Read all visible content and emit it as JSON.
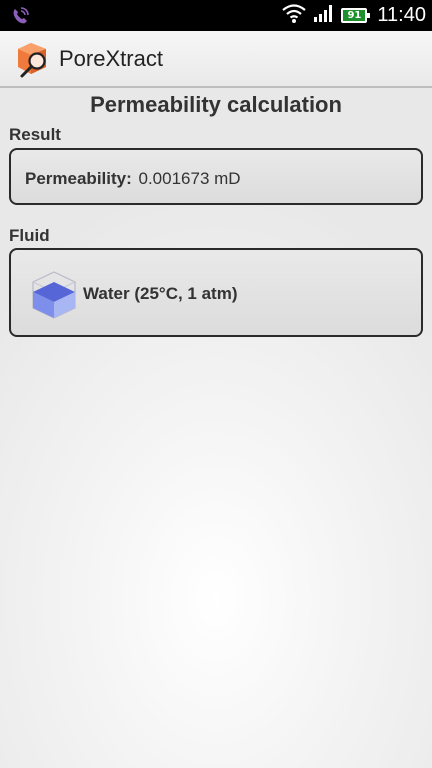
{
  "status_bar": {
    "time": "11:40",
    "battery_level": "91",
    "icons": [
      "viber-icon",
      "wifi-icon",
      "signal-icon",
      "battery-icon"
    ]
  },
  "action_bar": {
    "app_name": "PoreXtract",
    "icon": "porextract-logo-icon"
  },
  "page": {
    "title": "Permeability calculation"
  },
  "result": {
    "section_label": "Result",
    "label": "Permeability:",
    "value": "0.001673 mD"
  },
  "fluid": {
    "section_label": "Fluid",
    "name": "Water (25°C, 1 atm)",
    "icon": "water-cube-icon"
  },
  "colors": {
    "logo_orange": "#f07a3c",
    "water_blue": "#5a6fe0",
    "card_border": "#2a2a2a",
    "battery_green": "#1e8f2d"
  }
}
